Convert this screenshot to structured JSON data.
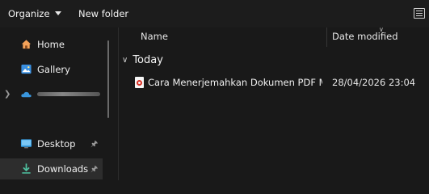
{
  "toolbar": {
    "organize_label": "Organize",
    "new_folder_label": "New folder"
  },
  "nav": {
    "items": [
      {
        "label": "Home",
        "icon": "home-icon"
      },
      {
        "label": "Gallery",
        "icon": "gallery-icon"
      },
      {
        "label": "",
        "icon": "onedrive-cloud-icon"
      },
      {
        "label": "Desktop",
        "icon": "desktop-icon",
        "pinned": true
      },
      {
        "label": "Downloads",
        "icon": "download-icon",
        "pinned": true,
        "selected": true
      }
    ]
  },
  "columns": {
    "name": "Name",
    "date_modified": "Date modified"
  },
  "group": {
    "label": "Today"
  },
  "files": [
    {
      "name": "Cara Menerjemahkan Dokumen PDF Me...",
      "date_modified": "28/04/2026 23:04",
      "icon": "pdf-file-icon"
    }
  ],
  "colors": {
    "background": "#191919",
    "selected": "#2d2d2d",
    "home_icon": "#f4a259",
    "onedrive": "#3a96dd",
    "download_icon": "#4fc3a1",
    "pdf_accent": "#d93025"
  }
}
